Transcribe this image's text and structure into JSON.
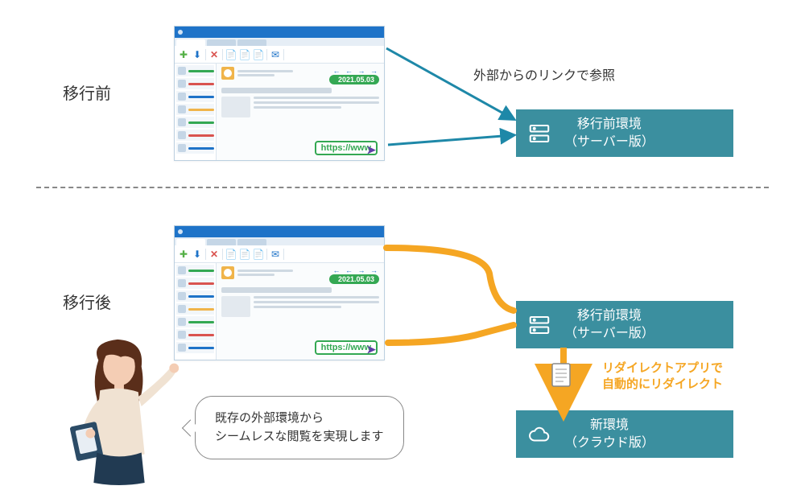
{
  "labels": {
    "before": "移行前",
    "after": "移行後",
    "external_link": "外部からのリンクで参照"
  },
  "app": {
    "date_badge": "2021.05.03",
    "url_text": "https://www",
    "nav_arrows": "← ← → →",
    "sidebar_colors": [
      "#34a853",
      "#d9534f",
      "#1e73c8",
      "#f0b44a",
      "#34a853",
      "#d9534f",
      "#1e73c8"
    ]
  },
  "env": {
    "before": {
      "line1": "移行前環境",
      "line2": "（サーバー版）"
    },
    "after_old": {
      "line1": "移行前環境",
      "line2": "（サーバー版）"
    },
    "after_new": {
      "line1": "新環境",
      "line2": "（クラウド版）"
    }
  },
  "redirect": {
    "line1": "リダイレクトアプリで",
    "line2": "自動的にリダイレクト"
  },
  "bubble": {
    "line1": "既存の外部環境から",
    "line2": "シームレスな閲覧を実現します"
  },
  "colors": {
    "blue_arrow": "#1e88a8",
    "orange_arrow": "#f5a623",
    "env_bg": "#3b8f9f"
  }
}
